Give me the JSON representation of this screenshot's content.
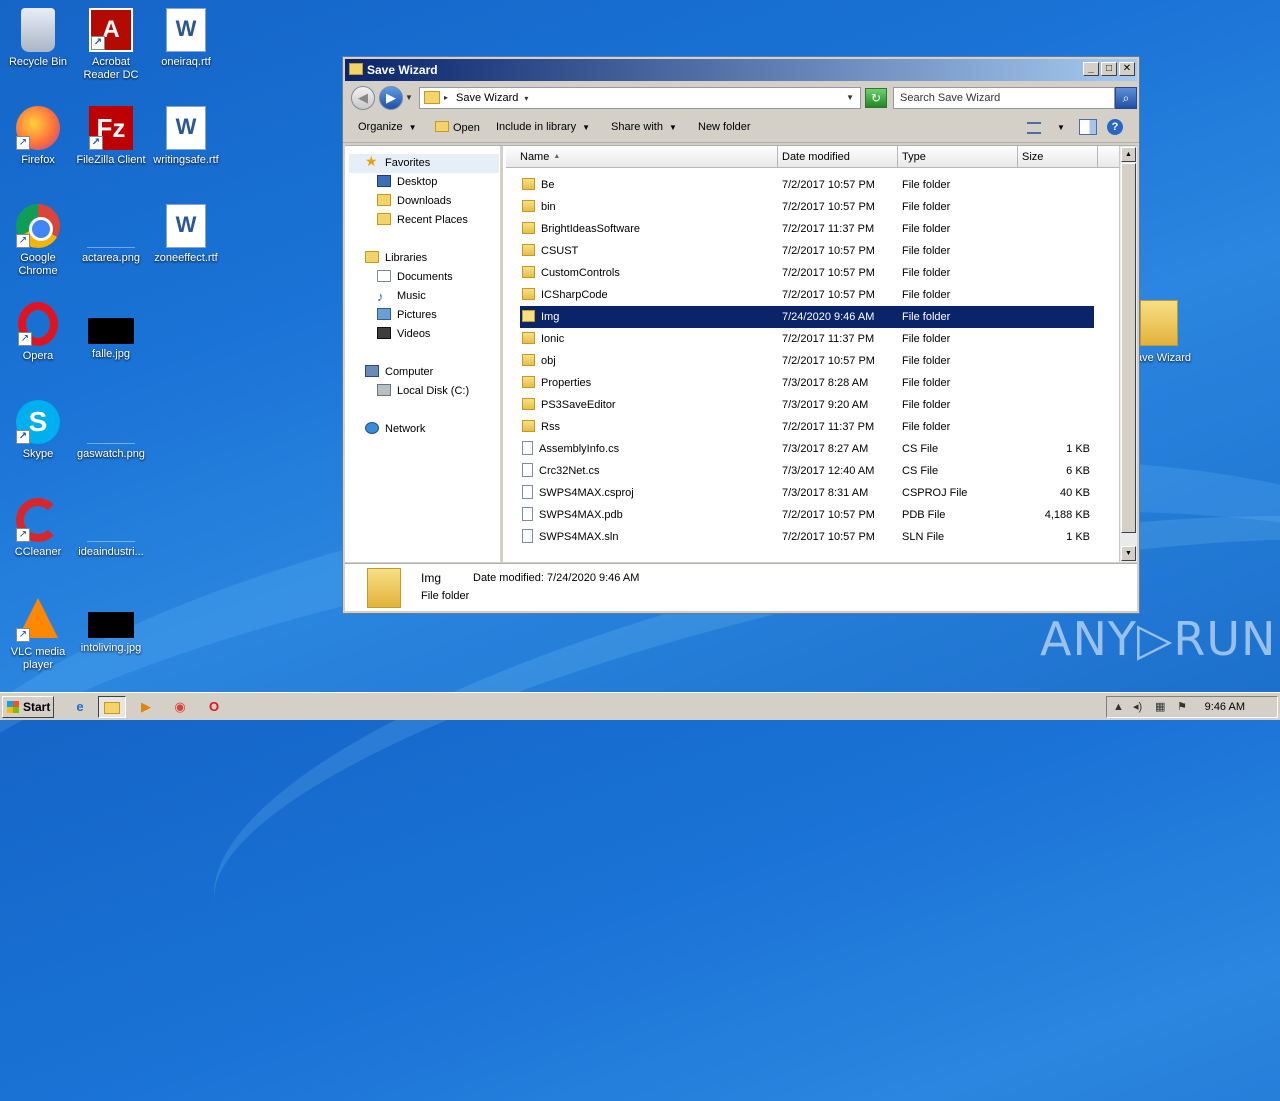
{
  "desktop": {
    "icons": [
      {
        "label": "Recycle Bin"
      },
      {
        "label": "Acrobat Reader DC"
      },
      {
        "label": "oneiraq.rtf"
      },
      {
        "label": "Firefox"
      },
      {
        "label": "FileZilla Client"
      },
      {
        "label": "writingsafe.rtf"
      },
      {
        "label": "Google Chrome"
      },
      {
        "label": "actarea.png"
      },
      {
        "label": "zoneeffect.rtf"
      },
      {
        "label": "Opera"
      },
      {
        "label": "falle.jpg"
      },
      {
        "label": "Skype"
      },
      {
        "label": "gaswatch.png"
      },
      {
        "label": "CCleaner"
      },
      {
        "label": "ideaindustri..."
      },
      {
        "label": "VLC media player"
      },
      {
        "label": "intoliving.jpg"
      }
    ],
    "behind_label": "ave Wizard",
    "watermark": "ANY▷RUN"
  },
  "window": {
    "title": "Save Wizard",
    "controls": {
      "minimize": "_",
      "maximize": "□",
      "close": "✕"
    },
    "address": {
      "path": "Save Wizard"
    },
    "search": {
      "placeholder": "Search Save Wizard"
    },
    "toolbar": {
      "organize": "Organize",
      "open": "Open",
      "include": "Include in library",
      "share": "Share with",
      "new_folder": "New folder"
    },
    "nav": {
      "favorites": "Favorites",
      "desktop": "Desktop",
      "downloads": "Downloads",
      "recent": "Recent Places",
      "libraries": "Libraries",
      "documents": "Documents",
      "music": "Music",
      "pictures": "Pictures",
      "videos": "Videos",
      "computer": "Computer",
      "local_disk": "Local Disk (C:)",
      "network": "Network"
    },
    "columns": {
      "name": "Name",
      "date": "Date modified",
      "type": "Type",
      "size": "Size"
    },
    "rows": [
      {
        "name": "Be",
        "date": "7/2/2017 10:57 PM",
        "type": "File folder",
        "size": "",
        "kind": "folder"
      },
      {
        "name": "bin",
        "date": "7/2/2017 10:57 PM",
        "type": "File folder",
        "size": "",
        "kind": "folder"
      },
      {
        "name": "BrightIdeasSoftware",
        "date": "7/2/2017 11:37 PM",
        "type": "File folder",
        "size": "",
        "kind": "folder"
      },
      {
        "name": "CSUST",
        "date": "7/2/2017 10:57 PM",
        "type": "File folder",
        "size": "",
        "kind": "folder"
      },
      {
        "name": "CustomControls",
        "date": "7/2/2017 10:57 PM",
        "type": "File folder",
        "size": "",
        "kind": "folder"
      },
      {
        "name": "ICSharpCode",
        "date": "7/2/2017 10:57 PM",
        "type": "File folder",
        "size": "",
        "kind": "folder"
      },
      {
        "name": "Img",
        "date": "7/24/2020 9:46 AM",
        "type": "File folder",
        "size": "",
        "kind": "folder",
        "selected": true
      },
      {
        "name": "Ionic",
        "date": "7/2/2017 11:37 PM",
        "type": "File folder",
        "size": "",
        "kind": "folder"
      },
      {
        "name": "obj",
        "date": "7/2/2017 10:57 PM",
        "type": "File folder",
        "size": "",
        "kind": "folder"
      },
      {
        "name": "Properties",
        "date": "7/3/2017 8:28 AM",
        "type": "File folder",
        "size": "",
        "kind": "folder"
      },
      {
        "name": "PS3SaveEditor",
        "date": "7/3/2017 9:20 AM",
        "type": "File folder",
        "size": "",
        "kind": "folder"
      },
      {
        "name": "Rss",
        "date": "7/2/2017 11:37 PM",
        "type": "File folder",
        "size": "",
        "kind": "folder"
      },
      {
        "name": "AssemblyInfo.cs",
        "date": "7/3/2017 8:27 AM",
        "type": "CS File",
        "size": "1 KB",
        "kind": "file"
      },
      {
        "name": "Crc32Net.cs",
        "date": "7/3/2017 12:40 AM",
        "type": "CS File",
        "size": "6 KB",
        "kind": "file"
      },
      {
        "name": "SWPS4MAX.csproj",
        "date": "7/3/2017 8:31 AM",
        "type": "CSPROJ File",
        "size": "40 KB",
        "kind": "file"
      },
      {
        "name": "SWPS4MAX.pdb",
        "date": "7/2/2017 10:57 PM",
        "type": "PDB File",
        "size": "4,188 KB",
        "kind": "file"
      },
      {
        "name": "SWPS4MAX.sln",
        "date": "7/2/2017 10:57 PM",
        "type": "SLN File",
        "size": "1 KB",
        "kind": "file"
      }
    ],
    "details": {
      "name": "Img",
      "modified_label": "Date modified:",
      "modified_value": "7/24/2020 9:46 AM",
      "type": "File folder"
    }
  },
  "taskbar": {
    "start": "Start",
    "clock": "9:46 AM"
  }
}
